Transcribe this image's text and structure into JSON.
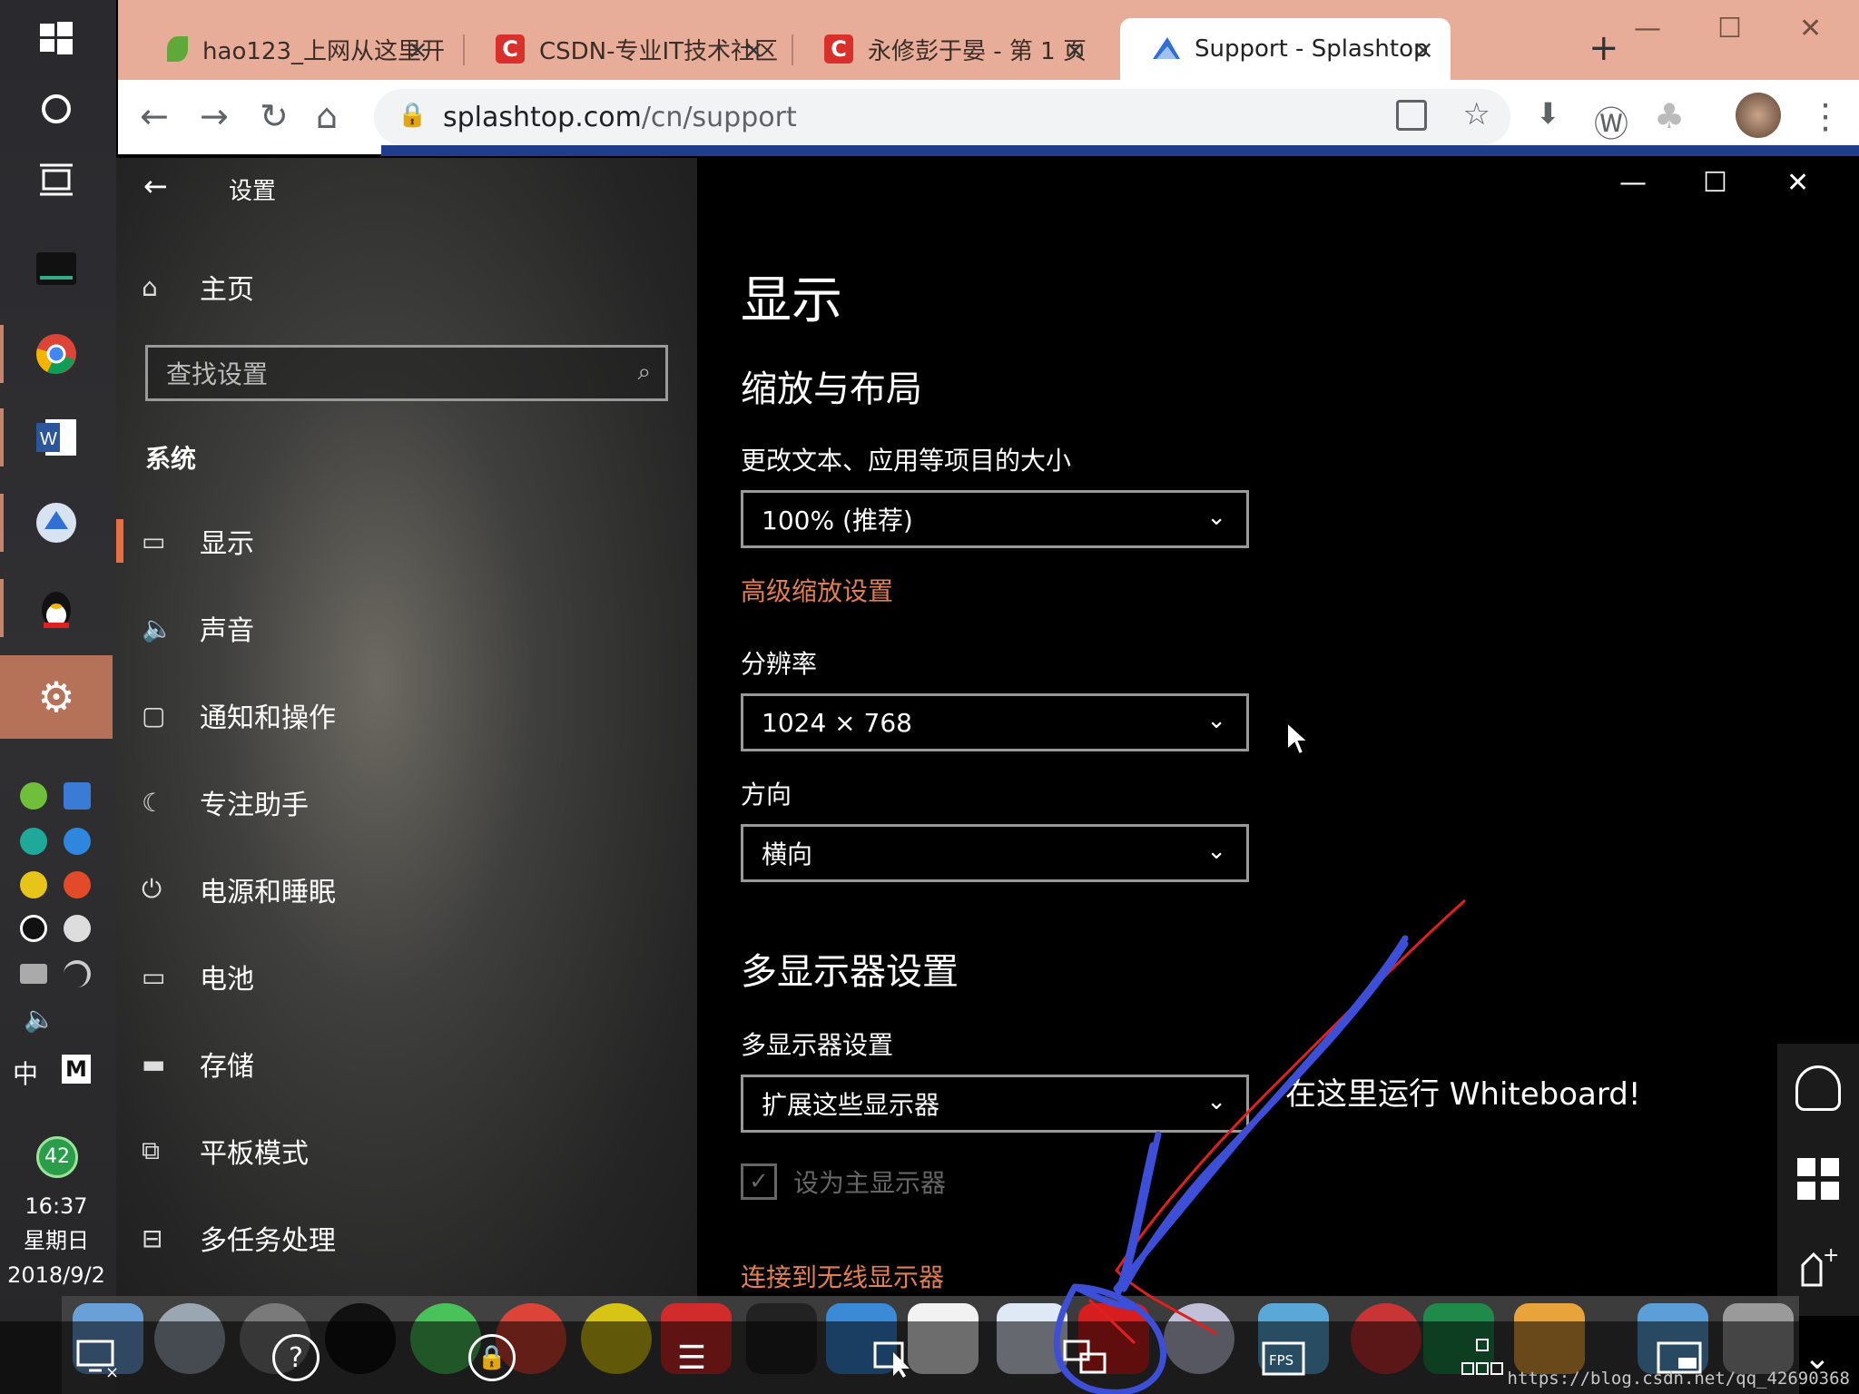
{
  "browser": {
    "tabs": [
      {
        "title": "hao123_上网从这里开",
        "icon_color": "#5ea93a"
      },
      {
        "title": "CSDN-专业IT技术社区",
        "icon_color": "#d9302b"
      },
      {
        "title": "永修彭于晏 - 第 1 页",
        "icon_color": "#d9302b"
      },
      {
        "title": "Support - Splashtop",
        "icon_color": "#2f6fd6"
      }
    ],
    "tab_close": "×",
    "new_tab": "+",
    "url_host": "splashtop.com",
    "url_path": "/cn/support"
  },
  "taskbar": {
    "time": "16:37",
    "weekday": "星期日",
    "date": "2018/9/2",
    "badge": "42",
    "ime_zh": "中",
    "ime_m": "M"
  },
  "settings": {
    "window_title": "设置",
    "home": "主页",
    "search_placeholder": "查找设置",
    "section": "系统",
    "nav": [
      {
        "label": "显示",
        "icon": "monitor-icon"
      },
      {
        "label": "声音",
        "icon": "speaker-icon"
      },
      {
        "label": "通知和操作",
        "icon": "notification-icon"
      },
      {
        "label": "专注助手",
        "icon": "moon-icon"
      },
      {
        "label": "电源和睡眠",
        "icon": "power-icon"
      },
      {
        "label": "电池",
        "icon": "battery-icon"
      },
      {
        "label": "存储",
        "icon": "storage-icon"
      },
      {
        "label": "平板模式",
        "icon": "tablet-icon"
      },
      {
        "label": "多任务处理",
        "icon": "multitask-icon"
      }
    ],
    "page_title": "显示",
    "scale_section": "缩放与布局",
    "scale_label": "更改文本、应用等项目的大小",
    "scale_value": "100% (推荐)",
    "advanced_scaling_link": "高级缩放设置",
    "resolution_label": "分辨率",
    "resolution_value": "1024 × 768",
    "orientation_label": "方向",
    "orientation_value": "横向",
    "multi_section": "多显示器设置",
    "multi_label": "多显示器设置",
    "multi_value": "扩展这些显示器",
    "primary_checkbox": "设为主显示器",
    "wireless_link": "连接到无线显示器"
  },
  "annotation": {
    "text": "在这里运行 Whiteboard!",
    "stroke_blue": "#3d4fd8",
    "stroke_red": "#e0201e"
  },
  "splashtop_bar": {
    "fps_label": "FPS"
  },
  "watermark": "https://blog.csdn.net/qq_42690368",
  "colors": {
    "accent_orange": "#e86f3f",
    "link_orange": "#e27e52",
    "tab_strip": "#e7ad98"
  }
}
